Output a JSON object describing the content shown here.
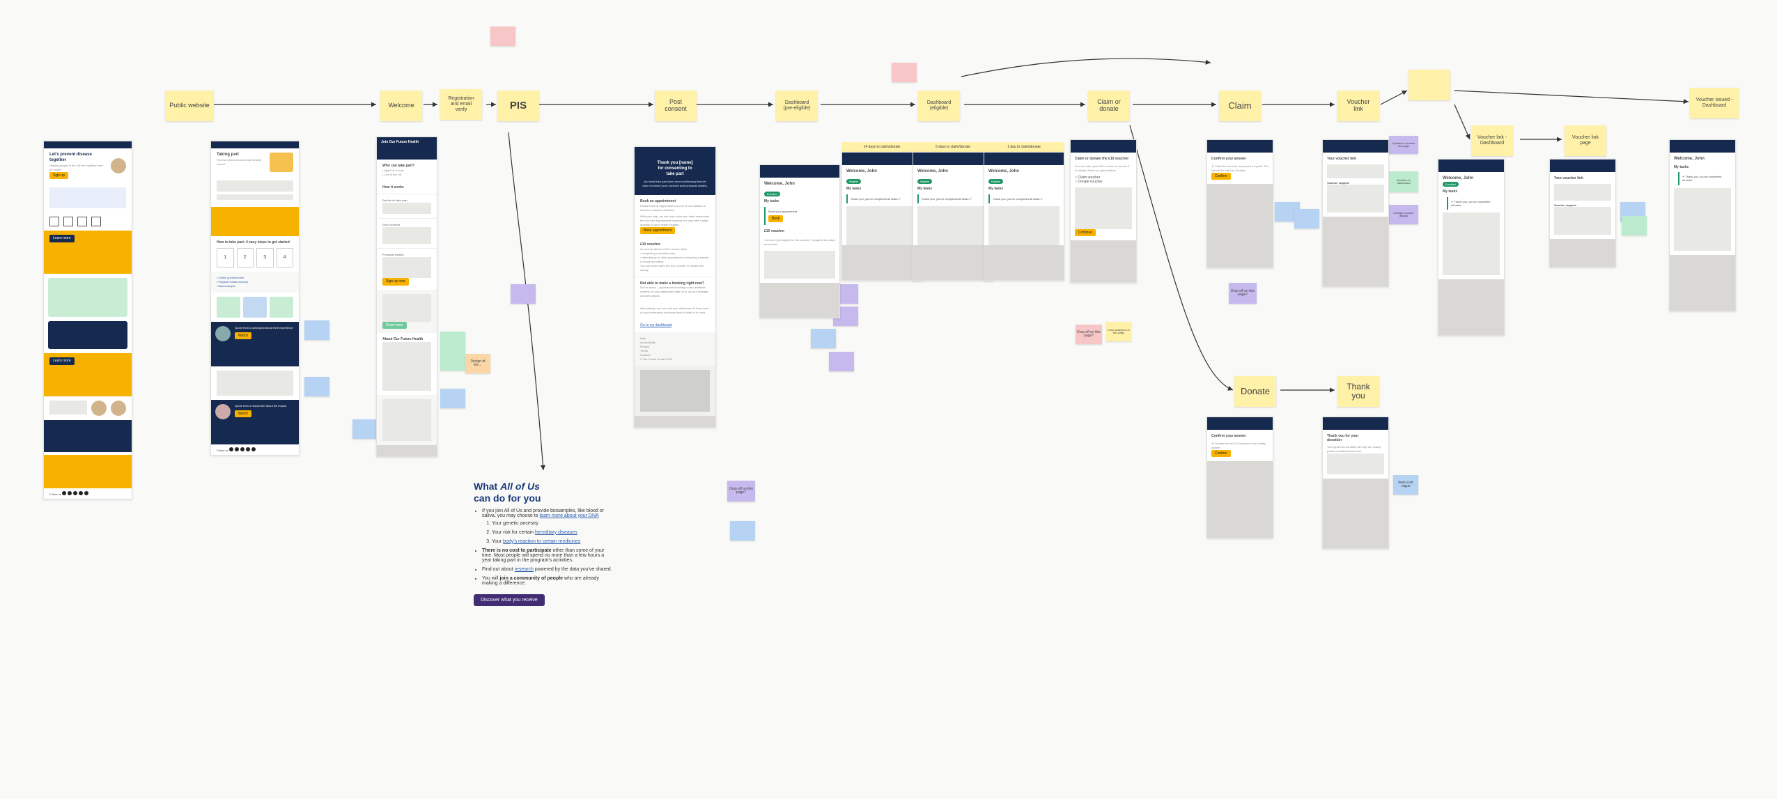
{
  "flow": {
    "public_website": "Public website",
    "welcome": "Welcome",
    "registration": "Registration and email verify",
    "pis": "PIS",
    "post_consent": "Post consent",
    "dash_pre": "Dashboard (pre-eligible)",
    "dash_eligible": "Dashboard (eligible)",
    "claim_or_donate": "Claim or donate",
    "claim": "Claim",
    "voucher_link": "Voucher link",
    "voucher_link_dash": "Voucher link - Dashboard",
    "voucher_link_page": "Voucher link page",
    "voucher_issued": "Voucher Issued - Dashboard",
    "donate": "Donate",
    "thank_you": "Thank you"
  },
  "dash_titles": {
    "d14": "14 days to claim/donate",
    "d5": "5 days to claim/donate",
    "d1": "1 day to claim/donate"
  },
  "public_page": {
    "hero_title": "Let's prevent disease together",
    "hero_sub": "Helping people in the UK live healthier lives for longer"
  },
  "taking_part": {
    "title": "Taking part",
    "steps_heading": "How to take part: 4 easy steps to get started",
    "steps": [
      "1",
      "2",
      "3",
      "4"
    ]
  },
  "join_panel": {
    "title": "Join Our Future Health",
    "who": "Who can take part?",
    "how_works": "How it works",
    "decide": "Decide to take part",
    "consent": "Give consent",
    "personal": "Personal details",
    "btn_signup": "Sign up now",
    "about": "About Our Future Health"
  },
  "post_consent_panel": {
    "thanks_line1": "Thank you [name]",
    "thanks_line2": "for consenting to",
    "thanks_line3": "take part",
    "book_heading": "Book an appointment",
    "book_btn": "Book appointment",
    "voucher_heading": "£10 voucher",
    "voucher_line": "As well as offered a £10 voucher after",
    "not_able": "Not able to make a booking right now?",
    "go_dash": "Go to my dashboard",
    "footer_links": [
      "Help",
      "Accessibility",
      "Privacy",
      "Terms",
      "Cookies",
      "© Our Future Health 2022"
    ]
  },
  "allofus": {
    "heading_pre": "What ",
    "heading_em": "All of Us",
    "heading_post": " can do for you",
    "li1_pre": "If you join All of Us and provide biosamples, like blood or saliva, you may choose to ",
    "li1_link": "learn more about your DNA",
    "sub_a": "Your genetic ancestry",
    "sub_b_pre": "Your risk for certain ",
    "sub_b_link": "hereditary diseases",
    "sub_c_pre": "Your ",
    "sub_c_link": "body's reaction to certain medicines",
    "li2_b": "There is no cost to participate",
    "li2_rest": " other than some of your time. Most people will spend no more than a few hours a year taking part in the program's activities.",
    "li3_pre": "Find out about ",
    "li3_link": "research",
    "li3_post": " powered by the data you've shared.",
    "li4_pre": "You will ",
    "li4_b": "join a community of people",
    "li4_post": " who are already making a difference.",
    "btn": "Discover what you receive"
  },
  "dash_common": {
    "welcome": "Welcome, John",
    "my_tasks": "My tasks",
    "task_book": "Book your appointment",
    "voucher_heading": "£10 voucher",
    "thank_you": "Thank you, you've completed all tasks"
  },
  "claim_donate": {
    "title": "Claim or donate the £10 voucher",
    "opt_claim": "Claim voucher",
    "opt_donate": "Donate voucher",
    "continue": "Continue"
  },
  "confirm": {
    "title": "Confirm your answer",
    "btn": "Confirm"
  },
  "voucher_link_page": {
    "title": "Your voucher link",
    "support": "Voucher support"
  },
  "thanks_donation": {
    "title_l1": "Thank you for your",
    "title_l2": "donation"
  },
  "stickies": {
    "drop_off": "Drop off on this page?",
    "feels_vague": "feels a bit vague",
    "design_info": "Design of the…",
    "add_time": "Add time to dashboard",
    "change_voucher": "Change voucher display",
    "update_link": "Update to voucher link page",
    "keep_stats": "Keep analytics on this page"
  },
  "follow_us": "Follow us"
}
